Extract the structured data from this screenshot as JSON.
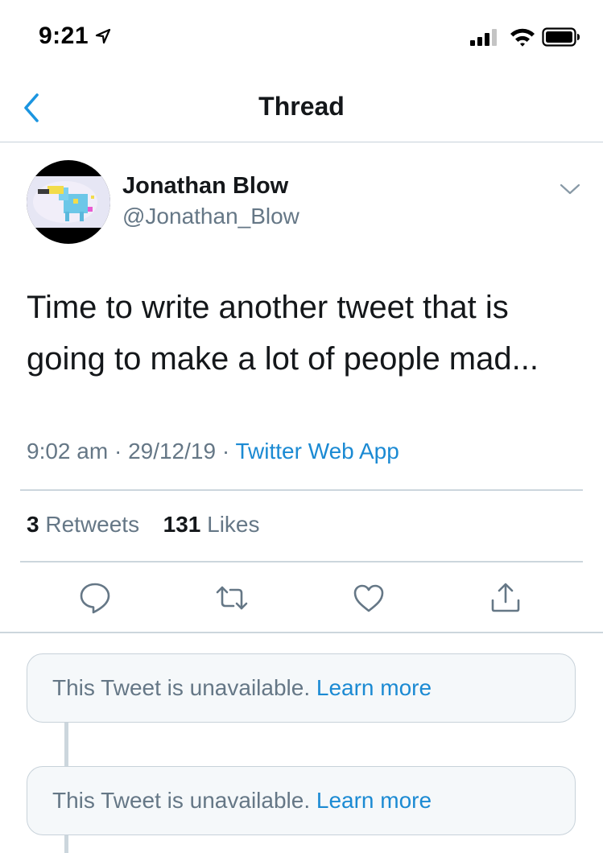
{
  "status_bar": {
    "time": "9:21"
  },
  "header": {
    "title": "Thread"
  },
  "tweet": {
    "author_name": "Jonathan Blow",
    "author_handle": "@Jonathan_Blow",
    "text": "Time to write another tweet that is going to make a lot of people mad...",
    "time": "9:02 am",
    "date": "29/12/19",
    "separator": "·",
    "source": "Twitter Web App",
    "retweets_count": "3",
    "retweets_label": "Retweets",
    "likes_count": "131",
    "likes_label": "Likes"
  },
  "actions": {
    "icons": [
      "reply-icon",
      "retweet-icon",
      "like-icon",
      "share-icon"
    ]
  },
  "replies": [
    {
      "text": "This Tweet is unavailable.",
      "link": "Learn more"
    },
    {
      "text": "This Tweet is unavailable.",
      "link": "Learn more"
    }
  ],
  "colors": {
    "accent": "#1b8ad3",
    "secondary_text": "#657786",
    "primary_text": "#14171a",
    "card_background": "#f5f8fa"
  }
}
